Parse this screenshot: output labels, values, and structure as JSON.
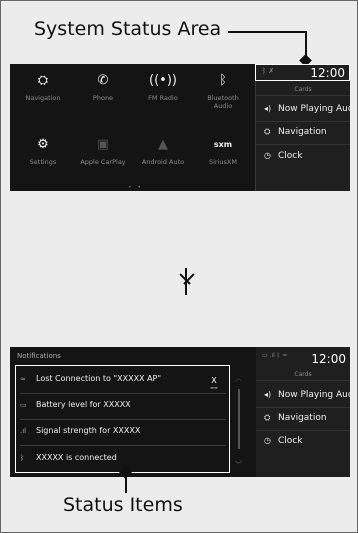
{
  "callouts": {
    "top": "System Status Area",
    "bottom": "Status Items"
  },
  "home": {
    "apps": [
      {
        "label": "Navigation",
        "icon": "navigation-icon"
      },
      {
        "label": "Phone",
        "icon": "phone-icon"
      },
      {
        "label": "FM Radio",
        "icon": "radio-icon"
      },
      {
        "label": "Bluetooth Audio",
        "icon": "bluetooth-icon"
      },
      {
        "label": "Settings",
        "icon": "gear-icon"
      },
      {
        "label": "Apple CarPlay",
        "icon": "carplay-icon"
      },
      {
        "label": "Android Auto",
        "icon": "android-auto-icon"
      },
      {
        "label": "SiriusXM",
        "icon": "siriusxm-icon"
      }
    ],
    "page_dots": "• •"
  },
  "right_panel": {
    "clock": "12:00",
    "cards_label": "Cards",
    "items": [
      {
        "label": "Now Playing Audi",
        "icon": "speaker-icon"
      },
      {
        "label": "Navigation",
        "icon": "navigation-icon"
      },
      {
        "label": "Clock",
        "icon": "clock-icon"
      }
    ]
  },
  "right_panel_2": {
    "clock": "12:00",
    "cards_label": "Cards",
    "items": [
      {
        "label": "Now Playing Auc",
        "icon": "speaker-icon"
      },
      {
        "label": "Navigation",
        "icon": "navigation-icon"
      },
      {
        "label": "Clock",
        "icon": "clock-icon"
      }
    ]
  },
  "notifications": {
    "title": "Notifications",
    "close_label": "X",
    "items": [
      {
        "text": "Lost Connection to \"XXXXX AP\"",
        "icon": "wifi-icon"
      },
      {
        "text": "Battery level for XXXXX",
        "icon": "battery-icon"
      },
      {
        "text": "Signal strength for XXXXX",
        "icon": "signal-icon"
      },
      {
        "text": "XXXXX is connected",
        "icon": "bluetooth-icon"
      }
    ]
  }
}
